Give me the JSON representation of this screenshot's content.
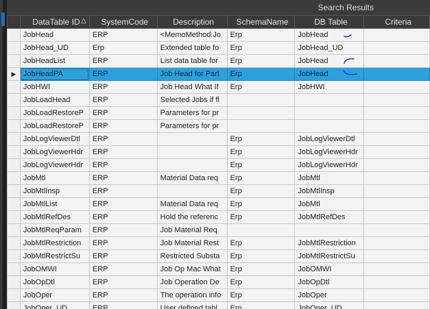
{
  "window": {
    "title": "Search Results"
  },
  "columns": [
    {
      "label": "DataTable ID",
      "sorted": "ascending"
    },
    {
      "label": "SystemCode"
    },
    {
      "label": "Description"
    },
    {
      "label": "SchemaName"
    },
    {
      "label": "DB Table"
    },
    {
      "label": "Criteria"
    }
  ],
  "rows": [
    {
      "id": "JobHead",
      "system": "ERP",
      "description": "<MemoMethod:Jo",
      "schema": "Erp",
      "db_table": "JobHead",
      "criteria": ""
    },
    {
      "id": "JobHead_UD",
      "system": "Erp",
      "description": "Extended table fo",
      "schema": "Erp",
      "db_table": "JobHead_UD",
      "criteria": ""
    },
    {
      "id": "JobHeadList",
      "system": "ERP",
      "description": "List data table for",
      "schema": "Erp",
      "db_table": "JobHead",
      "criteria": ""
    },
    {
      "id": "JobHeadPA",
      "system": "ERP",
      "description": "Job Head for Part",
      "schema": "Erp",
      "db_table": "JobHead",
      "criteria": "",
      "selected": true
    },
    {
      "id": "JobHWI",
      "system": "ERP",
      "description": "Job Head What If",
      "schema": "Erp",
      "db_table": "JobHWI",
      "criteria": ""
    },
    {
      "id": "JobLoadHead",
      "system": "ERP",
      "description": "Selected Jobs if fl",
      "schema": "",
      "db_table": "",
      "criteria": ""
    },
    {
      "id": "JobLoadRestoreP",
      "system": "ERP",
      "description": "Parameters for pr",
      "schema": "",
      "db_table": "",
      "criteria": ""
    },
    {
      "id": "JobLoadRestoreP",
      "system": "ERP",
      "description": "Parameters for pr",
      "schema": "",
      "db_table": "",
      "criteria": ""
    },
    {
      "id": "JobLogViewerDtl",
      "system": "ERP",
      "description": "",
      "schema": "Erp",
      "db_table": "JobLogViewerDtl",
      "criteria": ""
    },
    {
      "id": "JobLogViewerHdr",
      "system": "ERP",
      "description": "",
      "schema": "Erp",
      "db_table": "JobLogViewerHdr",
      "criteria": ""
    },
    {
      "id": "JobLogViewerHdr",
      "system": "ERP",
      "description": "",
      "schema": "Erp",
      "db_table": "JobLogViewerHdr",
      "criteria": ""
    },
    {
      "id": "JobMtl",
      "system": "ERP",
      "description": "Material Data req",
      "schema": "Erp",
      "db_table": "JobMtl",
      "criteria": ""
    },
    {
      "id": "JobMtlInsp",
      "system": "ERP",
      "description": "",
      "schema": "Erp",
      "db_table": "JobMtlInsp",
      "criteria": ""
    },
    {
      "id": "JobMtlList",
      "system": "ERP",
      "description": "Material Data req",
      "schema": "Erp",
      "db_table": "JobMtl",
      "criteria": ""
    },
    {
      "id": "JobMtlRefDes",
      "system": "ERP",
      "description": "Hold the referenc",
      "schema": "Erp",
      "db_table": "JobMtlRefDes",
      "criteria": ""
    },
    {
      "id": "JobMtlReqParam",
      "system": "ERP",
      "description": "Job Material Req",
      "schema": "",
      "db_table": "",
      "criteria": ""
    },
    {
      "id": "JobMtlRestriction",
      "system": "ERP",
      "description": "Job Material Rest",
      "schema": "Erp",
      "db_table": "JobMtlRestriction",
      "criteria": ""
    },
    {
      "id": "JobMtlRestrictSu",
      "system": "ERP",
      "description": "Restricted Substa",
      "schema": "Erp",
      "db_table": "JobMtlRestrictSu",
      "criteria": ""
    },
    {
      "id": "JobOMWI",
      "system": "ERP",
      "description": "Job Op Mac What",
      "schema": "Erp",
      "db_table": "JobOMWI",
      "criteria": ""
    },
    {
      "id": "JobOpDtl",
      "system": "ERP",
      "description": "Job Operation De",
      "schema": "Erp",
      "db_table": "JobOpDtl",
      "criteria": ""
    },
    {
      "id": "JobOper",
      "system": "ERP",
      "description": "The operation info",
      "schema": "Erp",
      "db_table": "JobOper",
      "criteria": ""
    },
    {
      "id": "JobOper_UD",
      "system": "ERP",
      "description": "User defined tabl",
      "schema": "Erp",
      "db_table": "JobOper_UD",
      "criteria": ""
    }
  ],
  "colors": {
    "selected_row": "#2aa1dd",
    "header_bg": "#3a3a3a",
    "annotation_ink": "#1a3fd6"
  }
}
